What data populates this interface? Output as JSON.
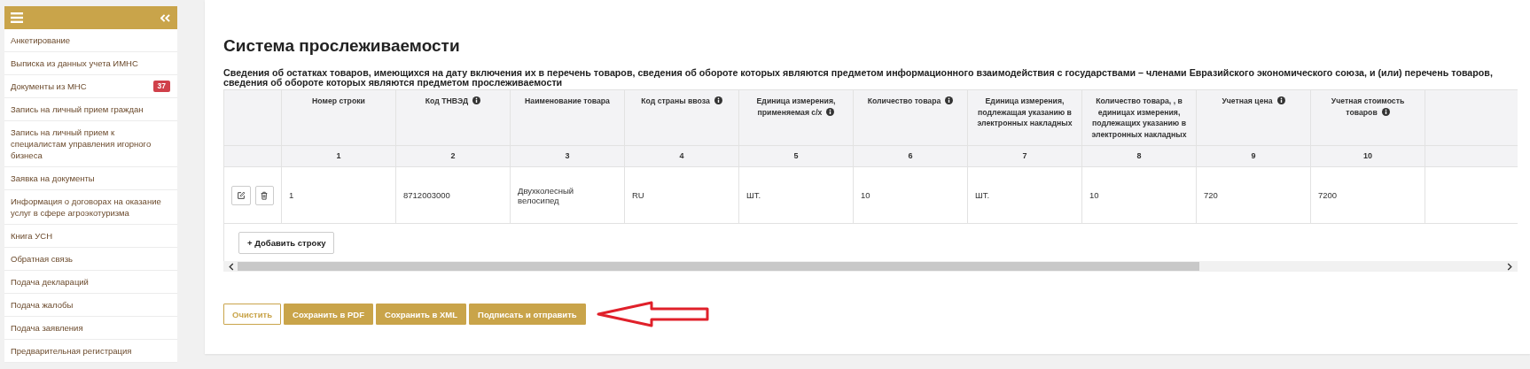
{
  "sidebar": {
    "items": [
      {
        "label": "Анкетирование"
      },
      {
        "label": "Выписка из данных учета ИМНС"
      },
      {
        "label": "Документы из МНС",
        "badge": "37"
      },
      {
        "label": "Запись на личный прием граждан"
      },
      {
        "label": "Запись на личный прием к специалистам управления игорного бизнеса"
      },
      {
        "label": "Заявка на документы"
      },
      {
        "label": "Информация о договорах на оказание услуг в сфере агроэкотуризма"
      },
      {
        "label": "Книга УСН"
      },
      {
        "label": "Обратная связь"
      },
      {
        "label": "Подача деклараций"
      },
      {
        "label": "Подача жалобы"
      },
      {
        "label": "Подача заявления"
      },
      {
        "label": "Предварительная регистрация"
      }
    ]
  },
  "page": {
    "title": "Система прослеживаемости",
    "description": "Сведения об остатках товаров, имеющихся на дату включения их в перечень товаров, сведения об обороте которых являются предметом информационного взаимодействия с государствами – членами Евразийского экономического союза, и (или) перечень товаров, сведения об обороте которых являются предметом прослеживаемости"
  },
  "table": {
    "columns": [
      {
        "label": "Номер строки",
        "number": "1",
        "info": false
      },
      {
        "label": "Код ТНВЭД",
        "number": "2",
        "info": true
      },
      {
        "label": "Наименование товара",
        "number": "3",
        "info": false
      },
      {
        "label": "Код страны ввоза",
        "number": "4",
        "info": true
      },
      {
        "label": "Единица измерения, применяемая с/х",
        "number": "5",
        "info": true
      },
      {
        "label": "Количество товара",
        "number": "6",
        "info": true
      },
      {
        "label": "Единица измерения, подлежащая указанию в электронных накладных",
        "number": "7",
        "info": false
      },
      {
        "label": "Количество товара, , в единицах измерения, подлежащих указанию в электронных накладных",
        "number": "8",
        "info": false
      },
      {
        "label": "Учетная цена",
        "number": "9",
        "info": true
      },
      {
        "label": "Учетная стоимость товаров",
        "number": "10",
        "info": true
      }
    ],
    "rows": [
      [
        "1",
        "8712003000",
        "Двухколесный велосипед",
        "RU",
        "ШТ.",
        "10",
        "ШТ.",
        "10",
        "720",
        "7200"
      ]
    ],
    "add_row_button": "+ Добавить строку"
  },
  "buttons": [
    {
      "label": "Очистить",
      "kind": "outline"
    },
    {
      "label": "Сохранить в PDF",
      "kind": "filled"
    },
    {
      "label": "Сохранить в XML",
      "kind": "filled"
    },
    {
      "label": "Подписать и отправить",
      "kind": "filled"
    }
  ]
}
